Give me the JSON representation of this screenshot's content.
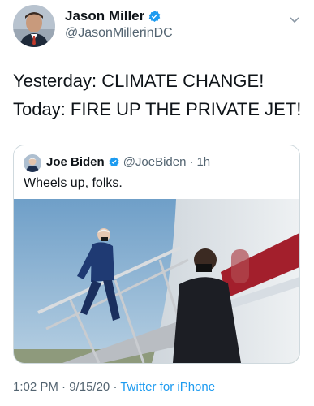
{
  "tweet": {
    "author_name": "Jason Miller",
    "author_handle": "@JasonMillerinDC",
    "lines": [
      "Yesterday: CLIMATE CHANGE!",
      "Today: FIRE UP THE PRIVATE JET!"
    ],
    "time": "1:02 PM",
    "date": "9/15/20",
    "source": "Twitter for iPhone",
    "separator": "·"
  },
  "quoted": {
    "author_name": "Joe Biden",
    "author_handle": "@JoeBiden",
    "separator": "·",
    "time_ago": "1h",
    "text": "Wheels up, folks."
  },
  "colors": {
    "verified_blue": "#1d9bf0",
    "link_blue": "#1d9bf0",
    "muted_gray": "#536471",
    "border_gray": "#cfd9de"
  }
}
